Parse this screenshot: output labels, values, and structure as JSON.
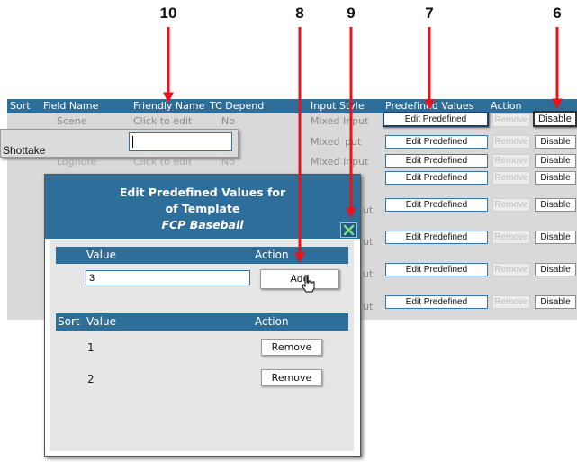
{
  "callouts": [
    "10",
    "8",
    "9",
    "7",
    "6"
  ],
  "table": {
    "headers": [
      "Sort",
      "Field Name",
      "Friendly Name",
      "TC Depend",
      "Input Style",
      "Predefined Values",
      "Action"
    ],
    "rows": [
      {
        "field": "Scene",
        "friendly": "Click to edit",
        "tc": "No",
        "input": "Mixed Input"
      },
      {
        "input": "Mixed Input"
      },
      {
        "field": "Lognote",
        "friendly": "Click to edit",
        "tc": "No",
        "input": "Mixed Input"
      },
      {
        "input": "ut"
      },
      {
        "input": "ut"
      },
      {
        "input": "ut"
      },
      {
        "input": "ut"
      },
      {
        "input": "ut"
      }
    ],
    "edit_label": "Edit Predefined",
    "remove_label": "Remove",
    "disable_label": "Disable"
  },
  "friendly_popup": {
    "label": "Shottake",
    "input_value": ""
  },
  "modal": {
    "title_line1": "Edit Predefined Values for",
    "title_line2": "of Template",
    "template_name": "FCP Baseball",
    "value_header": "Value",
    "action_header": "Action",
    "value_input": "3",
    "add_label": "Add",
    "list_sort_header": "Sort",
    "list_value_header": "Value",
    "list_action_header": "Action",
    "items": [
      {
        "value": "1",
        "remove_label": "Remove"
      },
      {
        "value": "2",
        "remove_label": "Remove"
      }
    ]
  },
  "colors": {
    "header_blue": "#2e6e9a",
    "callout_red": "#e8141b"
  }
}
